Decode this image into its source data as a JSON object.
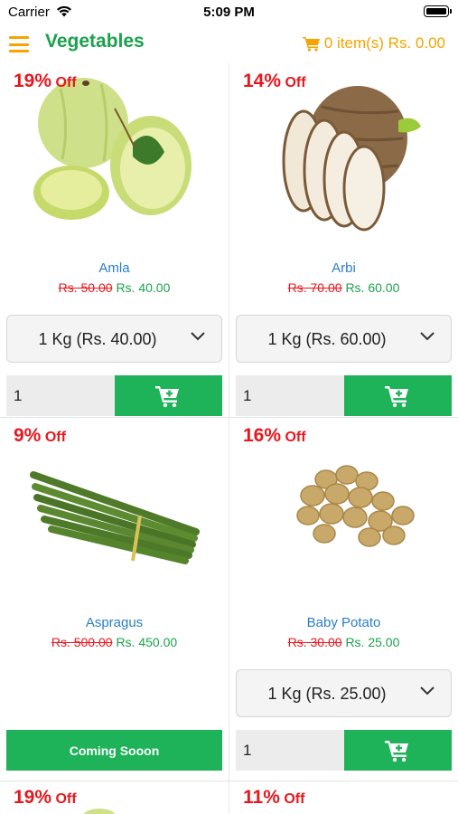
{
  "status_bar": {
    "carrier": "Carrier",
    "time": "5:09 PM"
  },
  "header": {
    "title": "Vegetables",
    "cart_summary": "0 item(s) Rs. 0.00"
  },
  "products": [
    {
      "discount": "19%",
      "off_label": "Off",
      "name": "Amla",
      "old_price": "Rs. 50.00",
      "new_price": "Rs. 40.00",
      "variant": "1 Kg (Rs. 40.00)",
      "quantity": "1"
    },
    {
      "discount": "14%",
      "off_label": "Off",
      "name": "Arbi",
      "old_price": "Rs. 70.00",
      "new_price": "Rs. 60.00",
      "variant": "1 Kg (Rs. 60.00)",
      "quantity": "1"
    },
    {
      "discount": "9%",
      "off_label": "Off",
      "name": "Aspragus",
      "old_price": "Rs. 500.00",
      "new_price": "Rs. 450.00",
      "coming_soon_label": "Coming Sooon"
    },
    {
      "discount": "16%",
      "off_label": "Off",
      "name": "Baby Potato",
      "old_price": "Rs. 30.00",
      "new_price": "Rs. 25.00",
      "variant": "1 Kg (Rs. 25.00)",
      "quantity": "1"
    },
    {
      "discount": "19%",
      "off_label": "Off"
    },
    {
      "discount": "11%",
      "off_label": "Off"
    }
  ],
  "colors": {
    "brand_green": "#1aa24c",
    "accent_orange": "#f5a400",
    "discount_red": "#e8161d",
    "name_blue": "#2a7ec8",
    "button_green": "#1eb259"
  },
  "icons": {
    "menu": "hamburger-icon",
    "cart": "cart-icon",
    "add_to_cart": "cart-plus-icon",
    "dropdown": "chevron-down-icon"
  }
}
